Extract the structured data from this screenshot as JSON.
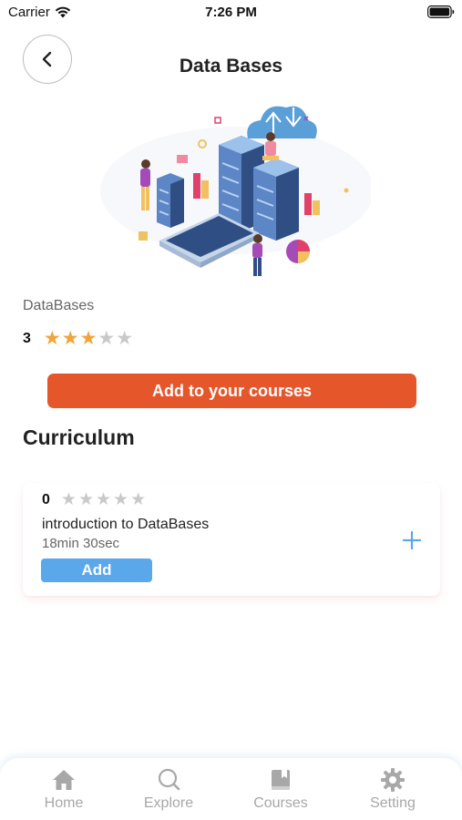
{
  "status_bar": {
    "carrier": "Carrier",
    "time": "7:26 PM"
  },
  "header": {
    "title": "Data Bases",
    "back_icon": "chevron-left-icon"
  },
  "course": {
    "name": "DataBases",
    "rating": "3",
    "rating_value": 3,
    "rating_max": 5,
    "add_button_label": "Add to your courses"
  },
  "curriculum": {
    "title": "Curriculum",
    "lessons": [
      {
        "rating": "0",
        "rating_value": 0,
        "title": "introduction to DataBases",
        "duration": "18min 30sec",
        "add_label": "Add",
        "expand_icon": "plus-icon"
      }
    ]
  },
  "tab_bar": {
    "items": [
      {
        "label": "Home",
        "icon": "home-icon"
      },
      {
        "label": "Explore",
        "icon": "search-icon"
      },
      {
        "label": "Courses",
        "icon": "book-icon"
      },
      {
        "label": "Setting",
        "icon": "gear-icon"
      }
    ]
  },
  "colors": {
    "primary_button": "#e5562a",
    "secondary_button": "#5aa7ea",
    "star_active": "#f2a33a",
    "star_inactive": "#c9c9c9",
    "tab_inactive": "#a8a8a8"
  }
}
